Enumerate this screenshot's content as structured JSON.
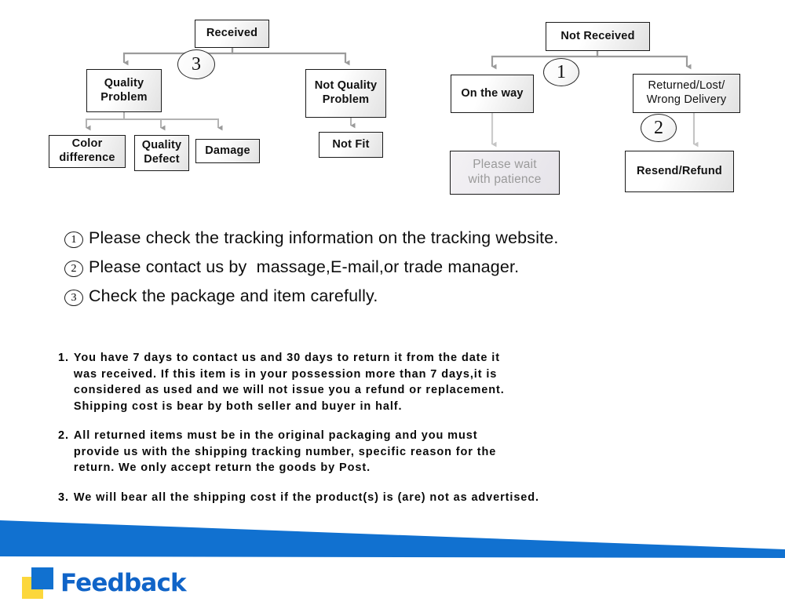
{
  "flowchart": {
    "left_tree": {
      "root": "Received",
      "marker": "3",
      "branch_quality": "Quality\nProblem",
      "branch_not_quality": "Not Quality\nProblem",
      "leaf_color": "Color\ndifference",
      "leaf_defect": "Quality\nDefect",
      "leaf_damage": "Damage",
      "leaf_not_fit": "Not Fit"
    },
    "right_tree": {
      "root": "Not  Received",
      "marker_1": "1",
      "marker_2": "2",
      "branch_on_the_way": "On the way",
      "branch_returned": "Returned/Lost/\nWrong Delivery",
      "leaf_please_wait": "Please wait\nwith patience",
      "leaf_resend": "Resend/Refund"
    }
  },
  "instructions": [
    {
      "num": "1",
      "text": "Please check the tracking information on the tracking website."
    },
    {
      "num": "2",
      "text": "Please contact us by  massage,E-mail,or trade manager."
    },
    {
      "num": "3",
      "text": "Check the package and item carefully."
    }
  ],
  "policy": [
    {
      "num": "1.",
      "text": "You have 7 days to contact us and 30 days to return it from the date it\nwas received. If this item is in your possession more than 7 days,it is\nconsidered as used and we will not issue you a refund or replacement.\nShipping cost is bear by both seller and buyer in half."
    },
    {
      "num": "2.",
      "text": "All returned items must be in the original packaging and you must\nprovide us with the shipping tracking number, specific reason for the\nreturn. We only accept return the goods by Post."
    },
    {
      "num": "3.",
      "text": "We will bear all the shipping cost if the product(s) is (are) not as advertised."
    }
  ],
  "footer": {
    "logo_text": "Feedback",
    "brand_blue": "#1064c8",
    "brand_yellow": "#fcd73c",
    "banner_blue": "#1171d0"
  }
}
